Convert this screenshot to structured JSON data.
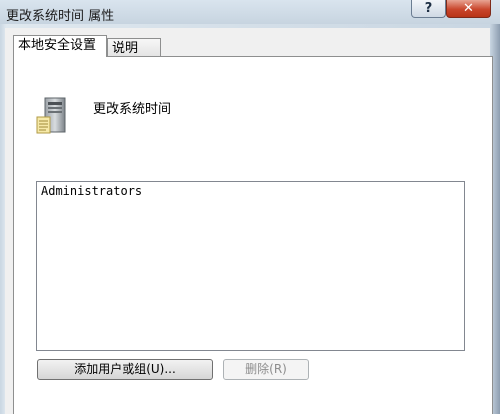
{
  "window": {
    "title": "更改系统时间 属性",
    "help_label": "?",
    "close_label": "✕"
  },
  "tabs": [
    {
      "label": "本地安全设置",
      "active": true
    },
    {
      "label": "说明",
      "active": false
    }
  ],
  "policy": {
    "title": "更改系统时间",
    "icon": "server-computer-icon"
  },
  "members": [
    "Administrators"
  ],
  "buttons": {
    "add_label": "添加用户或组(U)...",
    "remove_label": "删除(R)",
    "remove_disabled": true
  }
}
